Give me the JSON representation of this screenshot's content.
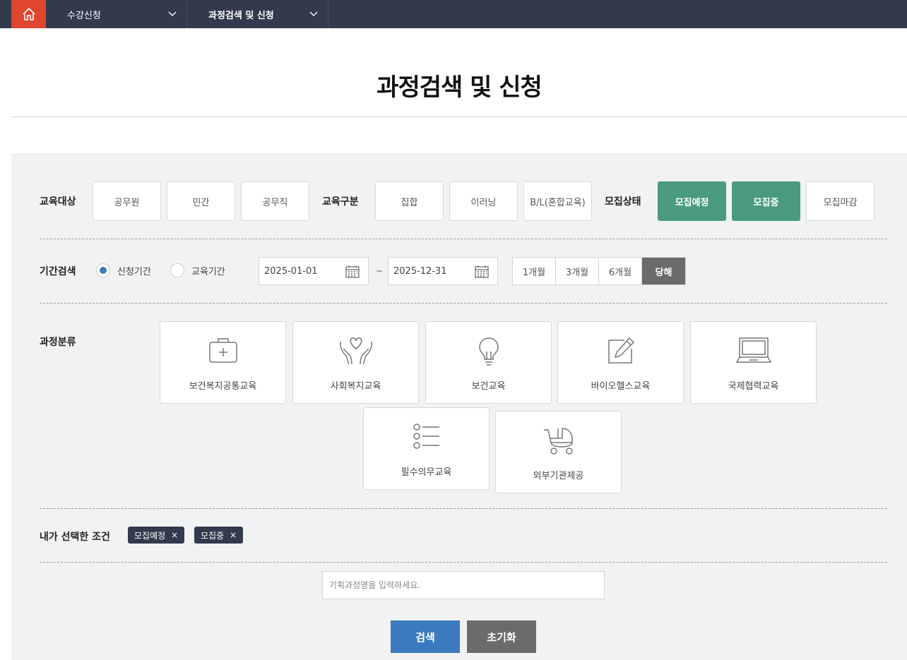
{
  "nav": {
    "items": [
      {
        "label": "수강신청"
      },
      {
        "label": "과정검색 및 신청"
      }
    ]
  },
  "page_title": "과정검색 및 신청",
  "filters": {
    "target": {
      "label": "교육대상",
      "options": [
        "공무원",
        "민간",
        "공무직"
      ]
    },
    "type": {
      "label": "교육구분",
      "options": [
        "집합",
        "이러닝",
        "B/L(혼합교육)"
      ]
    },
    "status": {
      "label": "모집상태",
      "options": [
        "모집예정",
        "모집중",
        "모집마감"
      ],
      "selected": [
        "모집예정",
        "모집중"
      ]
    }
  },
  "period_search": {
    "label": "기간검색",
    "radios": [
      {
        "label": "신청기간",
        "checked": true
      },
      {
        "label": "교육기간",
        "checked": false
      }
    ],
    "start_date": "2025-01-01",
    "end_date": "2025-12-31",
    "separator": "~",
    "ranges": [
      "1개월",
      "3개월",
      "6개월",
      "당해"
    ],
    "selected_range": "당해"
  },
  "categories": {
    "label": "과정분류",
    "items": [
      {
        "label": "보건복지공통교육",
        "icon": "first-aid-kit-icon"
      },
      {
        "label": "사회복지교육",
        "icon": "hands-heart-icon"
      },
      {
        "label": "보건교육",
        "icon": "lightbulb-icon"
      },
      {
        "label": "바이오헬스교육",
        "icon": "edit-icon"
      },
      {
        "label": "국제협력교육",
        "icon": "laptop-icon"
      },
      {
        "label": "필수의무교육",
        "icon": "list-icon"
      },
      {
        "label": "외부기관제공",
        "icon": "stroller-icon"
      }
    ]
  },
  "selected_conditions": {
    "label": "내가 선택한 조건",
    "chips": [
      {
        "label": "모집예정",
        "remove": "×"
      },
      {
        "label": "모집중",
        "remove": "×"
      }
    ]
  },
  "search": {
    "placeholder": "기획과정명을 입력하세요.",
    "search_label": "검색",
    "reset_label": "초기화"
  },
  "colors": {
    "nav_bg": "#323a4d",
    "home_bg": "#e0452d",
    "status_active": "#4a9a80",
    "search_btn": "#3b7abf",
    "reset_btn": "#6b6b6b"
  }
}
